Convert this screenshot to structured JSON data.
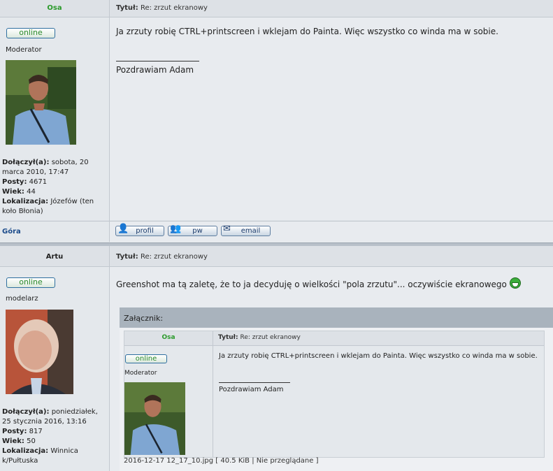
{
  "post1": {
    "author": "Osa",
    "title_label": "Tytuł:",
    "title_value": "Re: zrzut ekranowy",
    "status": "online",
    "rank": "Moderator",
    "info": {
      "joined_label": "Dołączył(a):",
      "joined_value": "sobota, 20 marca 2010, 17:47",
      "posts_label": "Posty:",
      "posts_value": "4671",
      "age_label": "Wiek:",
      "age_value": "44",
      "location_label": "Lokalizacja:",
      "location_value": "Józefów (ten koło Błonia)"
    },
    "message": "Ja zrzuty robię CTRL+printscreen i wklejam do Painta. Więc wszystko co winda ma w sobie.",
    "signature": "Pozdrawiam Adam",
    "top_link": "Góra",
    "buttons": {
      "profile": "profil",
      "pm": "pw",
      "email": "email"
    }
  },
  "post2": {
    "author": "Artu",
    "title_label": "Tytuł:",
    "title_value": "Re: zrzut ekranowy",
    "status": "online",
    "rank": "modelarz",
    "info": {
      "joined_label": "Dołączył(a):",
      "joined_value": "poniedziałek, 25 stycznia 2016, 13:16",
      "posts_label": "Posty:",
      "posts_value": "817",
      "age_label": "Wiek:",
      "age_value": "50",
      "location_label": "Lokalizacja:",
      "location_value": "Winnica k/Pułtuska"
    },
    "message": "Greenshot ma tą zaletę, że to ja decyduję o wielkości \"pola zrzutu\"... oczywiście ekranowego",
    "attachment": {
      "header": "Załącznik:",
      "caption": "2016-12-17 12_17_10.jpg [ 40.5 KiB | Nie przeglądane ]",
      "inner": {
        "author": "Osa",
        "title_label": "Tytuł:",
        "title_value": "Re: zrzut ekranowy",
        "status": "online",
        "rank": "Moderator",
        "message": "Ja zrzuty robię CTRL+printscreen i wklejam do Painta. Więc wszystko co winda ma w sobie.",
        "signature": "Pozdrawiam Adam"
      }
    }
  },
  "colors": {
    "online": "#2a9a2a",
    "link": "#1a4a8a",
    "header_bg": "#dde1e6",
    "attach_header": "#a9b3bd"
  },
  "icons": [
    "profile-icon",
    "pm-icon",
    "email-icon",
    "grin-smiley-icon"
  ]
}
